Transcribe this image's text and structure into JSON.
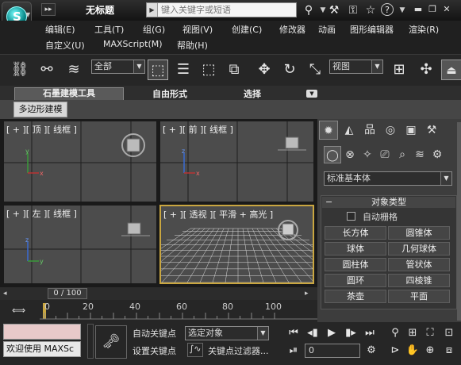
{
  "title": "无标题",
  "search": {
    "placeholder": "键入关键字或短语"
  },
  "menu": [
    "编辑(E)",
    "工具(T)",
    "组(G)",
    "视图(V)",
    "创建(C)",
    "修改器",
    "动画",
    "图形编辑器",
    "渲染(R)",
    "自定义(U)",
    "MAXScript(M)",
    "帮助(H)"
  ],
  "toolbar": {
    "selection_filter": "全部",
    "ref_coord": "视图"
  },
  "ribbon": {
    "tabs": [
      "石墨建模工具",
      "自由形式",
      "选择"
    ],
    "subtab": "多边形建模"
  },
  "viewports": [
    {
      "label": "[ + ][ 顶 ][ 线框 ]"
    },
    {
      "label": "[ + ][ 前 ][ 线框 ]"
    },
    {
      "label": "[ + ][ 左 ][ 线框 ]"
    },
    {
      "label": "[ + ][ 透视 ][ 平滑 + 高光 ]"
    }
  ],
  "timeline": {
    "slider_label": "0 / 100",
    "ticks": [
      "0",
      "20",
      "40",
      "60",
      "80",
      "100"
    ]
  },
  "status": {
    "welcome": "欢迎使用 MAXSc",
    "auto_key": "自动关键点",
    "set_key": "设置关键点",
    "selection_set": "选定对象",
    "key_filters": "关键点过滤器...",
    "frame": "0"
  },
  "command_panel": {
    "category": "标准基本体",
    "rollout_title": "对象类型",
    "autogrid": "自动栅格",
    "buttons": [
      "长方体",
      "圆锥体",
      "球体",
      "几何球体",
      "圆柱体",
      "管状体",
      "圆环",
      "四棱锥",
      "茶壶",
      "平面"
    ]
  },
  "colors": {
    "active_viewport": "#c9a640",
    "viewport_bg": "#4c4c4c"
  }
}
